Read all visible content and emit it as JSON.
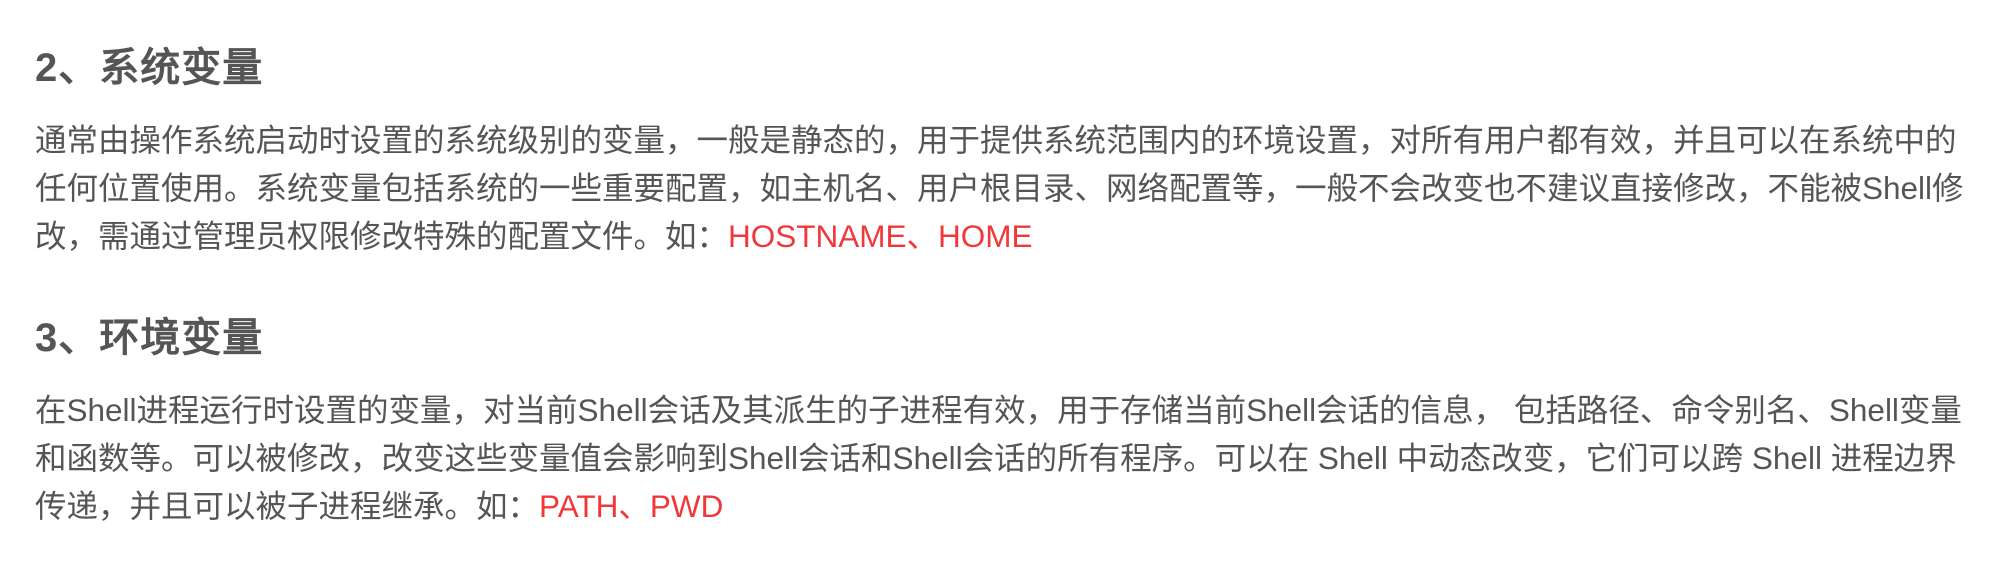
{
  "sections": [
    {
      "title": "2、系统变量",
      "body": "通常由操作系统启动时设置的系统级别的变量，一般是静态的，用于提供系统范围内的环境设置，对所有用户都有效，并且可以在系统中的任何位置使用。系统变量包括系统的一些重要配置，如主机名、用户根目录、网络配置等，一般不会改变也不建议直接修改，不能被Shell修改，需通过管理员权限修改特殊的配置文件。如：",
      "highlight": "HOSTNAME、HOME"
    },
    {
      "title": "3、环境变量",
      "body": "在Shell进程运行时设置的变量，对当前Shell会话及其派生的子进程有效，用于存储当前Shell会话的信息，  包括路径、命令别名、Shell变量和函数等。可以被修改，改变这些变量值会影响到Shell会话和Shell会话的所有程序。可以在 Shell 中动态改变，它们可以跨 Shell 进程边界传递，并且可以被子进程继承。如：",
      "highlight": "PATH、PWD"
    }
  ],
  "colors": {
    "text": "#555555",
    "highlight": "#f0383a",
    "background": "#ffffff"
  }
}
